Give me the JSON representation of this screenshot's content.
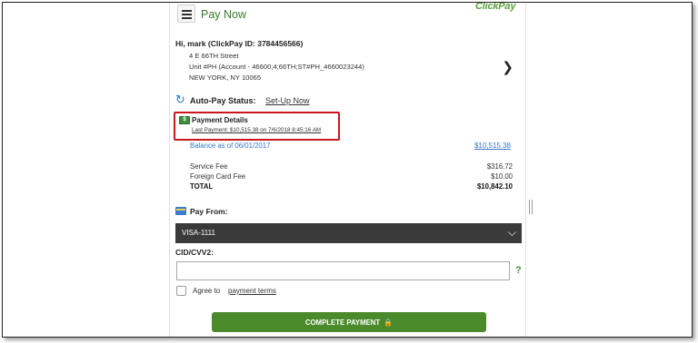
{
  "header": {
    "title": "Pay Now",
    "logo_text": "ClickPay",
    "menu_icon": "hamburger-icon"
  },
  "greeting": "Hi, mark (ClickPay ID: 3784456566)",
  "address": {
    "line1": "4 E 66TH Street",
    "line2": "Unit #PH (Account - 46600;4;66TH;ST#PH_4660023244)",
    "line3": "NEW YORK, NY 10065"
  },
  "autopay": {
    "label": "Auto-Pay Status:",
    "link": "Set-Up Now"
  },
  "payment_details": {
    "icon_text": "$",
    "title": "Payment Details",
    "last_payment": "Last Payment: $10,515.38 on 7/6/2018 8:45:16 AM"
  },
  "balance": {
    "label": "Balance as of 06/01/2017",
    "amount": "$10,515.38"
  },
  "fees": [
    {
      "label": "Service Fee",
      "value": "$316.72"
    },
    {
      "label": "Foreign Card Fee",
      "value": "$10.00"
    },
    {
      "label": "TOTAL",
      "value": "$10,842.10"
    }
  ],
  "pay_from": {
    "label": "Pay From:",
    "selected": "VISA-1111"
  },
  "cvv": {
    "label": "CID/CVV2:",
    "value": "",
    "help": "?"
  },
  "agree": {
    "text": "Agree to",
    "terms_link": "payment terms"
  },
  "submit": {
    "label": "COMPLETE PAYMENT",
    "icon": "lock-icon"
  },
  "colors": {
    "brand_green": "#4a8a2a",
    "link_blue": "#3a78c8",
    "highlight_red": "#c8181e",
    "select_bg": "#3a3a3a"
  }
}
